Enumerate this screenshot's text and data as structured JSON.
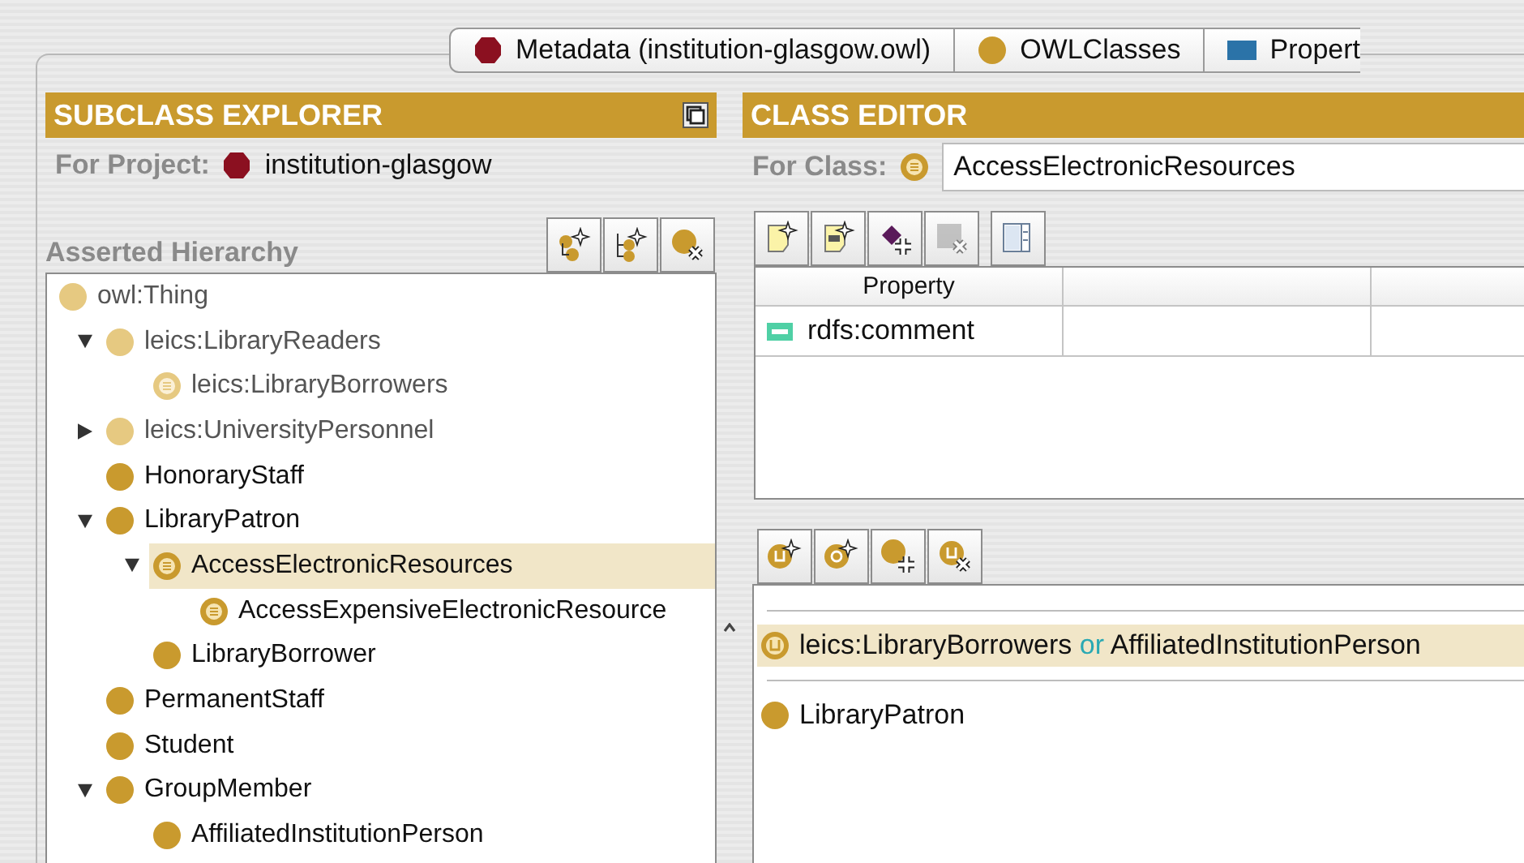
{
  "tabs": [
    {
      "label": "Metadata (institution-glasgow.owl)",
      "kind": "project"
    },
    {
      "label": "OWLClasses",
      "kind": "class"
    },
    {
      "label": "Propert",
      "kind": "property"
    }
  ],
  "subclass_explorer": {
    "title": "SUBCLASS EXPLORER",
    "project_label": "For Project:",
    "project_name": "institution-glasgow",
    "hierarchy_label": "Asserted Hierarchy",
    "toolbar": [
      {
        "kind": "addsubclass",
        "disabled": false
      },
      {
        "kind": "addsibling",
        "disabled": false
      },
      {
        "kind": "deleteclass",
        "disabled": false
      }
    ],
    "tree": [
      {
        "label": "owl:Thing",
        "kind": "imported",
        "selected": false,
        "children": [
          {
            "label": "leics:LibraryReaders",
            "kind": "imported",
            "selected": false,
            "expanded": true,
            "children": [
              {
                "label": "leics:LibraryBorrowers",
                "kind": "importeddefined",
                "selected": false
              }
            ]
          },
          {
            "label": "leics:UniversityPersonnel",
            "kind": "imported",
            "selected": false,
            "expanded": false
          },
          {
            "label": "HonoraryStaff",
            "kind": "primitive",
            "selected": false
          },
          {
            "label": "LibraryPatron",
            "kind": "primitive",
            "selected": false,
            "expanded": true,
            "children": [
              {
                "label": "AccessElectronicResources",
                "kind": "defined",
                "selected": true,
                "expanded": true,
                "children": [
                  {
                    "label": "AccessExpensiveElectronicResource",
                    "kind": "defined",
                    "selected": false
                  }
                ]
              },
              {
                "label": "LibraryBorrower",
                "kind": "primitive",
                "selected": false
              }
            ]
          },
          {
            "label": "PermanentStaff",
            "kind": "primitive",
            "selected": false
          },
          {
            "label": "Student",
            "kind": "primitive",
            "selected": false
          },
          {
            "label": "GroupMember",
            "kind": "primitive",
            "selected": false,
            "expanded": true,
            "children": [
              {
                "label": "AffiliatedInstitutionPerson",
                "kind": "primitive",
                "selected": false
              }
            ]
          }
        ]
      }
    ]
  },
  "class_editor": {
    "title": "CLASS EDITOR",
    "class_label": "For Class:",
    "class_name": "AccessElectronicResources",
    "toolbar": [
      {
        "kind": "note",
        "disabled": false
      },
      {
        "kind": "notedoc",
        "disabled": false
      },
      {
        "kind": "addproperty",
        "disabled": false
      },
      {
        "kind": "removeproperty",
        "disabled": true
      },
      {
        "kind": "columns",
        "disabled": false
      }
    ],
    "table": {
      "columns": [
        "Property"
      ],
      "rows": [
        {
          "property": "rdfs:comment"
        }
      ]
    },
    "condition_toolbar": [
      {
        "kind": "union",
        "disabled": false
      },
      {
        "kind": "restriction",
        "disabled": false
      },
      {
        "kind": "addclass",
        "disabled": false
      },
      {
        "kind": "removeclass",
        "disabled": false
      }
    ],
    "conditions": [
      {
        "kind": "separator"
      },
      {
        "kind": "union",
        "selected": true,
        "parts": [
          {
            "text": "leics:LibraryBorrowers"
          },
          {
            "text": "or",
            "kind": "keyword"
          },
          {
            "text": "AffiliatedInstitutionPerson"
          }
        ]
      },
      {
        "kind": "separator"
      },
      {
        "kind": "primitive",
        "selected": false,
        "parts": [
          {
            "text": "LibraryPatron"
          }
        ]
      }
    ]
  }
}
